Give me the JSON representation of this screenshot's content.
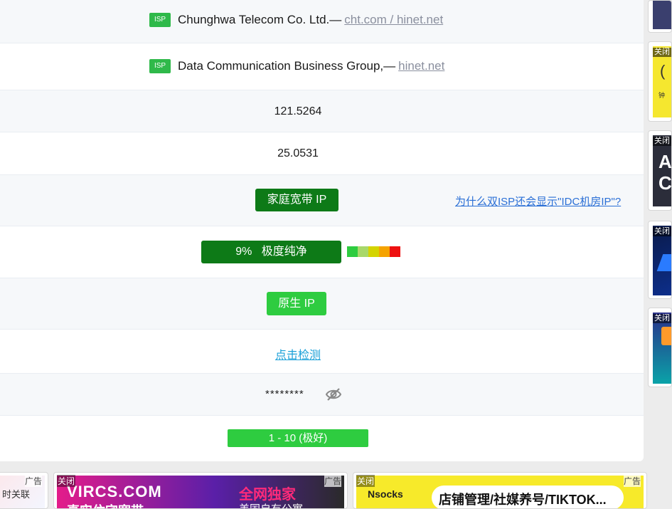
{
  "rows": {
    "isp1": {
      "badge": "ISP",
      "name": "Chunghwa Telecom Co. Ltd.—",
      "link": "cht.com / hinet.net"
    },
    "isp2": {
      "badge": "ISP",
      "name": "Data Communication Business Group,—",
      "link": "hinet.net"
    },
    "longitude": "121.5264",
    "latitude": "25.0531",
    "ip_type": {
      "label": "家庭宽带 IP",
      "help_link": "为什么双ISP还会显示\"IDC机房IP\"?"
    },
    "purity": {
      "label": "9%   极度纯净",
      "scale_colors": [
        "#2ecc40",
        "#a8d86a",
        "#d4d400",
        "#f5a300",
        "#ee1111"
      ]
    },
    "native": "原生 IP",
    "check_link": "点击检测",
    "masked": "********",
    "score": "1 - 10 (极好)"
  },
  "sidebar": {
    "close_label": "关闭",
    "cards": [
      {
        "text": ""
      },
      {
        "text": "钟"
      },
      {
        "text": "A\nCl"
      },
      {
        "text": ""
      },
      {
        "text": ""
      }
    ]
  },
  "ads": [
    {
      "close": "",
      "tag": "广告",
      "text": "时关联"
    },
    {
      "close": "关闭",
      "tag": "广告",
      "headline": "VIRCS.COM",
      "highlight": "全网独家",
      "sub": "真实住宅宽带",
      "sub2": "美国自有公寓"
    },
    {
      "close": "关闭",
      "tag": "广告",
      "brand": "Nsocks",
      "headline": "店铺管理/社媒养号/TIKTOK..."
    }
  ],
  "colors": {
    "accent_green": "#2ecc40",
    "dark_green": "#0d7a17",
    "link_blue": "#2a6fd6"
  }
}
